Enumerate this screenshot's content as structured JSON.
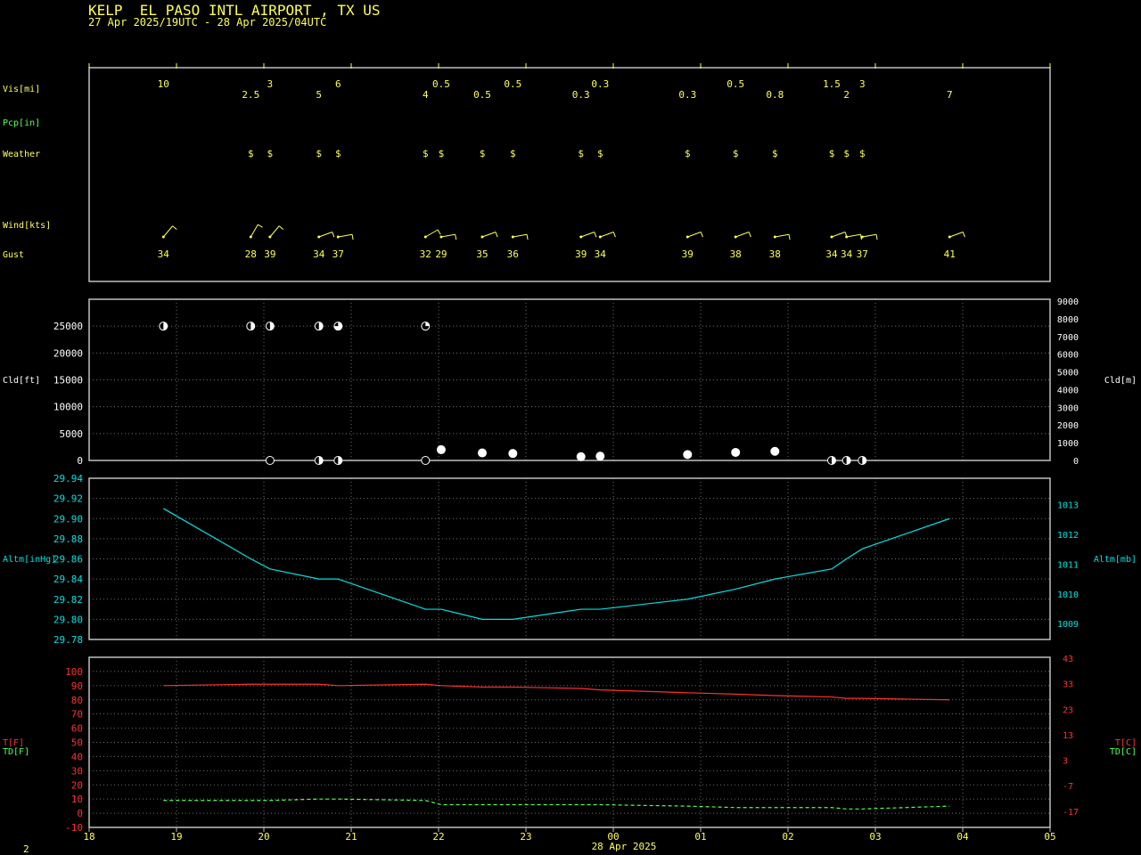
{
  "header": {
    "station": "KELP  EL PASO INTL AIRPORT , TX US",
    "period": "27 Apr 2025/19UTC - 28 Apr 2025/04UTC"
  },
  "footer": {
    "page": "2",
    "date_label": "28 Apr 2025"
  },
  "labels": {
    "vis": "Vis[mi]",
    "pcp": "Pcp[in]",
    "weather": "Weather",
    "wind": "Wind[kts]",
    "gust": "Gust",
    "cld_ft": "Cld[ft]",
    "cld_m": "Cld[m]",
    "altm_inhg": "Altm[inHg]",
    "altm_mb": "Altm[mb]",
    "t_f": "T[F]",
    "td_f": "TD[F]",
    "t_c": "T[C]",
    "td_c": "TD[C]"
  },
  "colors": {
    "frame": "#c0c0c0",
    "text": "#ffff55",
    "green": "#55ff55",
    "cyan": "#00e0e0",
    "red": "#ff3030",
    "grid": "#707070",
    "white": "#ffffff"
  },
  "chart_data": [
    {
      "type": "table",
      "name": "surface-observations",
      "x_hours": [
        0.85,
        1.85,
        2.07,
        2.63,
        2.85,
        3.85,
        4.03,
        4.5,
        4.85,
        5.63,
        5.85,
        6.85,
        7.4,
        7.85,
        8.5,
        8.67,
        8.85,
        9.85
      ],
      "vis_upper": [
        {
          "x": 0.85,
          "v": "10"
        },
        {
          "x": 2.07,
          "v": "3"
        },
        {
          "x": 2.85,
          "v": "6"
        },
        {
          "x": 4.03,
          "v": "0.5"
        },
        {
          "x": 4.85,
          "v": "0.5"
        },
        {
          "x": 5.85,
          "v": "0.3"
        },
        {
          "x": 7.4,
          "v": "0.5"
        },
        {
          "x": 8.5,
          "v": "1.5"
        },
        {
          "x": 8.85,
          "v": "3"
        }
      ],
      "vis_lower": [
        {
          "x": 1.85,
          "v": "2.5"
        },
        {
          "x": 2.63,
          "v": "5"
        },
        {
          "x": 3.85,
          "v": "4"
        },
        {
          "x": 4.5,
          "v": "0.5"
        },
        {
          "x": 5.63,
          "v": "0.3"
        },
        {
          "x": 6.85,
          "v": "0.3"
        },
        {
          "x": 7.85,
          "v": "0.8"
        },
        {
          "x": 8.67,
          "v": "2"
        },
        {
          "x": 9.85,
          "v": "7"
        }
      ],
      "weather": [
        {
          "x": 1.85,
          "v": "$"
        },
        {
          "x": 2.07,
          "v": "$"
        },
        {
          "x": 2.63,
          "v": "$"
        },
        {
          "x": 2.85,
          "v": "$"
        },
        {
          "x": 3.85,
          "v": "$"
        },
        {
          "x": 4.03,
          "v": "$"
        },
        {
          "x": 4.5,
          "v": "$"
        },
        {
          "x": 4.85,
          "v": "$"
        },
        {
          "x": 5.63,
          "v": "$"
        },
        {
          "x": 5.85,
          "v": "$"
        },
        {
          "x": 6.85,
          "v": "$"
        },
        {
          "x": 7.4,
          "v": "$"
        },
        {
          "x": 7.85,
          "v": "$"
        },
        {
          "x": 8.5,
          "v": "$"
        },
        {
          "x": 8.67,
          "v": "$"
        },
        {
          "x": 8.85,
          "v": "$"
        }
      ],
      "gust": [
        {
          "x": 0.85,
          "v": "34"
        },
        {
          "x": 1.85,
          "v": "28"
        },
        {
          "x": 2.07,
          "v": "39"
        },
        {
          "x": 2.63,
          "v": "34"
        },
        {
          "x": 2.85,
          "v": "37"
        },
        {
          "x": 3.85,
          "v": "32"
        },
        {
          "x": 4.03,
          "v": "29"
        },
        {
          "x": 4.5,
          "v": "35"
        },
        {
          "x": 4.85,
          "v": "36"
        },
        {
          "x": 5.63,
          "v": "39"
        },
        {
          "x": 5.85,
          "v": "34"
        },
        {
          "x": 6.85,
          "v": "39"
        },
        {
          "x": 7.4,
          "v": "38"
        },
        {
          "x": 7.85,
          "v": "38"
        },
        {
          "x": 8.5,
          "v": "34"
        },
        {
          "x": 8.67,
          "v": "34"
        },
        {
          "x": 8.85,
          "v": "37"
        },
        {
          "x": 9.85,
          "v": "41"
        }
      ],
      "wind_dir_deg": [
        {
          "x": 0.85,
          "dir": 220
        },
        {
          "x": 1.85,
          "dir": 210
        },
        {
          "x": 2.07,
          "dir": 220
        },
        {
          "x": 2.63,
          "dir": 250
        },
        {
          "x": 2.85,
          "dir": 260
        },
        {
          "x": 3.85,
          "dir": 240
        },
        {
          "x": 4.03,
          "dir": 260
        },
        {
          "x": 4.5,
          "dir": 250
        },
        {
          "x": 4.85,
          "dir": 260
        },
        {
          "x": 5.63,
          "dir": 250
        },
        {
          "x": 5.85,
          "dir": 250
        },
        {
          "x": 6.85,
          "dir": 250
        },
        {
          "x": 7.4,
          "dir": 250
        },
        {
          "x": 7.85,
          "dir": 260
        },
        {
          "x": 8.5,
          "dir": 250
        },
        {
          "x": 8.67,
          "dir": 260
        },
        {
          "x": 8.85,
          "dir": 260
        },
        {
          "x": 9.85,
          "dir": 250
        }
      ]
    },
    {
      "type": "scatter",
      "name": "cloud-layers",
      "ylim": [
        0,
        30000
      ],
      "yticks_ft": [
        0,
        5000,
        10000,
        15000,
        20000,
        25000
      ],
      "yticks_m": [
        0,
        1000,
        2000,
        3000,
        4000,
        5000,
        6000,
        7000,
        8000,
        9000
      ],
      "points": [
        {
          "x": 0.85,
          "y": 25000,
          "cover": "half"
        },
        {
          "x": 1.85,
          "y": 25000,
          "cover": "half"
        },
        {
          "x": 2.07,
          "y": 25000,
          "cover": "half"
        },
        {
          "x": 2.63,
          "y": 25000,
          "cover": "half"
        },
        {
          "x": 2.85,
          "y": 25000,
          "cover": "three-quarter"
        },
        {
          "x": 3.85,
          "y": 25000,
          "cover": "quarter"
        },
        {
          "x": 2.07,
          "y": 0,
          "cover": "empty"
        },
        {
          "x": 2.63,
          "y": 0,
          "cover": "half"
        },
        {
          "x": 2.85,
          "y": 0,
          "cover": "half"
        },
        {
          "x": 3.85,
          "y": 0,
          "cover": "empty"
        },
        {
          "x": 4.03,
          "y": 2000,
          "cover": "full"
        },
        {
          "x": 4.5,
          "y": 1400,
          "cover": "full"
        },
        {
          "x": 4.85,
          "y": 1300,
          "cover": "full"
        },
        {
          "x": 5.63,
          "y": 700,
          "cover": "full"
        },
        {
          "x": 5.85,
          "y": 800,
          "cover": "full"
        },
        {
          "x": 6.85,
          "y": 1100,
          "cover": "full"
        },
        {
          "x": 7.4,
          "y": 1500,
          "cover": "full"
        },
        {
          "x": 7.85,
          "y": 1700,
          "cover": "full"
        },
        {
          "x": 8.5,
          "y": 0,
          "cover": "half"
        },
        {
          "x": 8.67,
          "y": 0,
          "cover": "half"
        },
        {
          "x": 8.85,
          "y": 0,
          "cover": "half"
        }
      ]
    },
    {
      "type": "line",
      "name": "altimeter",
      "ylim": [
        29.78,
        29.94
      ],
      "yticks_inhg": [
        "29.78",
        "29.80",
        "29.82",
        "29.84",
        "29.86",
        "29.88",
        "29.90",
        "29.92",
        "29.94"
      ],
      "yticks_mb": [
        1009,
        1010,
        1011,
        1012,
        1013
      ],
      "x": [
        0.85,
        1.85,
        2.07,
        2.63,
        2.85,
        3.85,
        4.03,
        4.5,
        4.85,
        5.63,
        5.85,
        6.85,
        7.4,
        7.85,
        8.5,
        8.67,
        8.85,
        9.85
      ],
      "values": [
        29.91,
        29.86,
        29.85,
        29.84,
        29.84,
        29.81,
        29.81,
        29.8,
        29.8,
        29.81,
        29.81,
        29.82,
        29.83,
        29.84,
        29.85,
        29.86,
        29.87,
        29.9
      ]
    },
    {
      "type": "line",
      "name": "temperature-dewpoint",
      "ylim": [
        -10,
        110
      ],
      "yticks_f": [
        -10,
        0,
        10,
        20,
        30,
        40,
        50,
        60,
        70,
        80,
        90,
        100
      ],
      "yticks_c": [
        "43",
        "33",
        "23",
        "13",
        "3",
        "-7",
        "-17"
      ],
      "x": [
        0.85,
        1.85,
        2.07,
        2.63,
        2.85,
        3.85,
        4.03,
        4.5,
        4.85,
        5.63,
        5.85,
        6.85,
        7.4,
        7.85,
        8.5,
        8.67,
        8.85,
        9.85
      ],
      "series": [
        {
          "name": "T[F]",
          "color": "#ff3030",
          "style": "solid",
          "values": [
            90,
            91,
            91,
            91,
            90,
            91,
            90,
            89,
            89,
            88,
            87,
            85,
            84,
            83,
            82,
            81,
            81,
            80
          ]
        },
        {
          "name": "TD[F]",
          "color": "#55ff55",
          "style": "dashed",
          "values": [
            9,
            9,
            9,
            10,
            10,
            9,
            6,
            6,
            6,
            6,
            6,
            5,
            4,
            4,
            4,
            3,
            3,
            5
          ]
        }
      ]
    }
  ],
  "x_axis": {
    "ticks": [
      "18",
      "19",
      "20",
      "21",
      "22",
      "23",
      "00",
      "01",
      "02",
      "03",
      "04",
      "05"
    ]
  }
}
